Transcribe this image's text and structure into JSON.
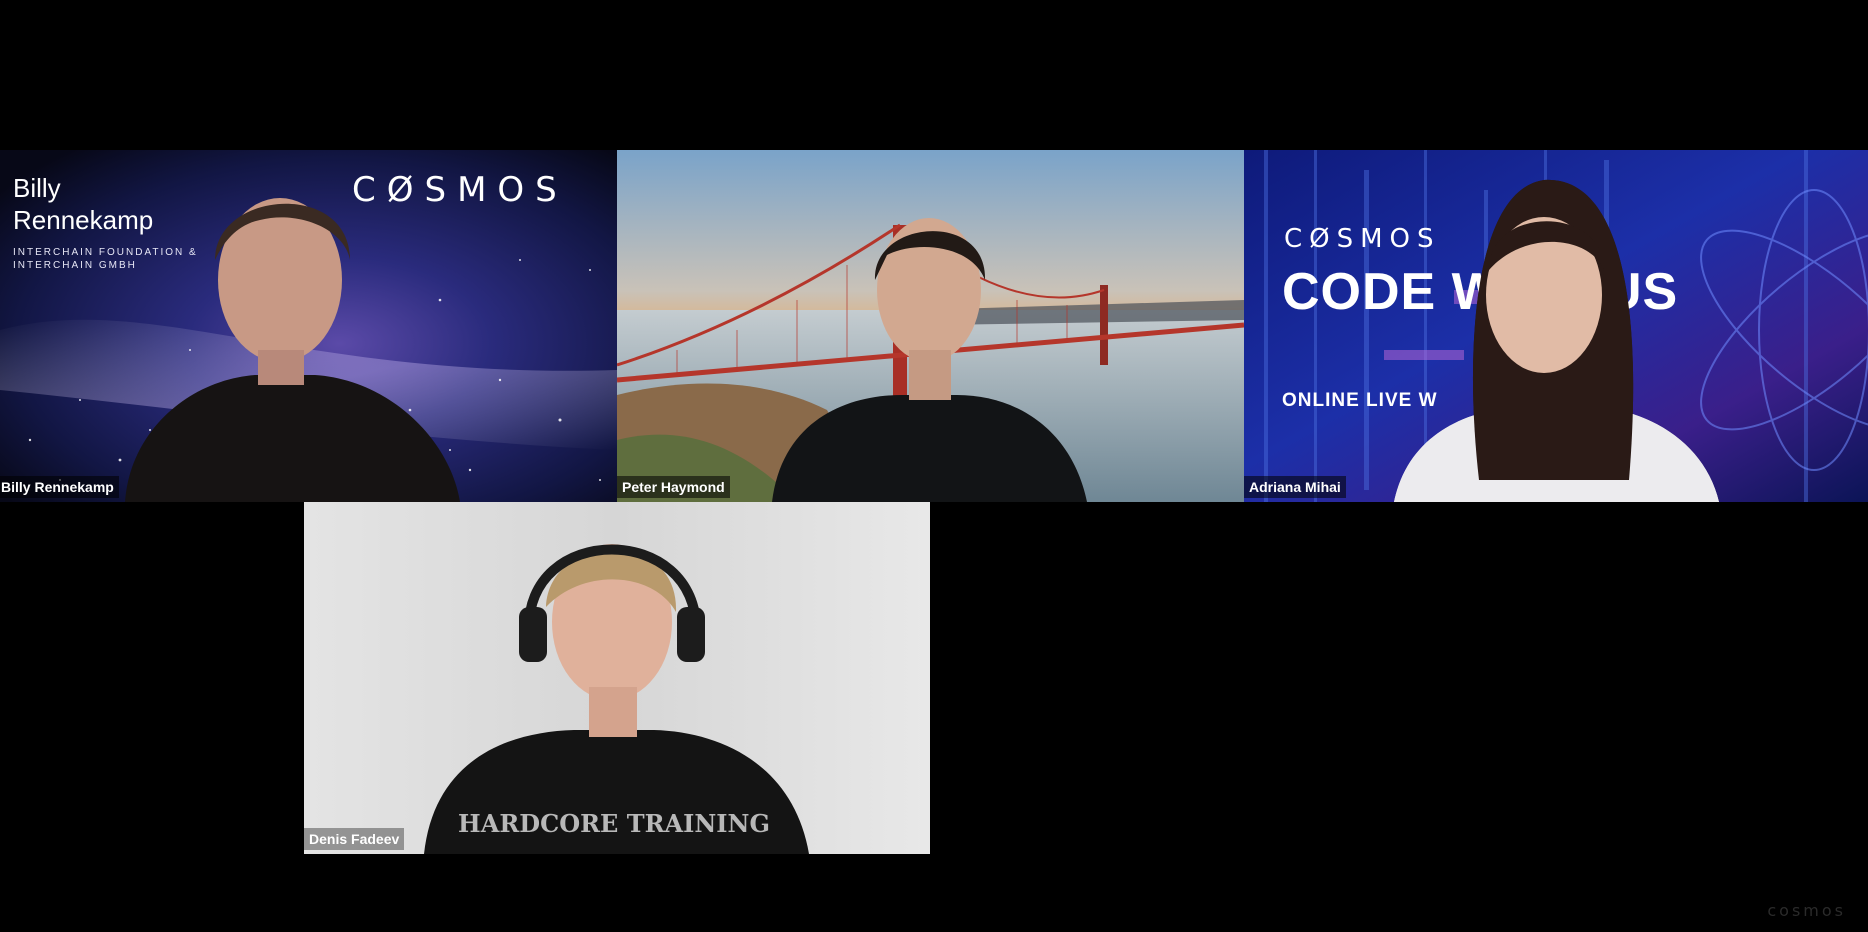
{
  "meeting": {
    "participants": [
      {
        "display_name": "Billy Rennekamp",
        "background": {
          "name_line1": "Billy",
          "name_line2": "Rennekamp",
          "org_line1": "INTERCHAIN FOUNDATION &",
          "org_line2": "INTERCHAIN GMBH",
          "brand": "CØSMOS",
          "theme": "galaxy"
        }
      },
      {
        "display_name": "Peter Haymond",
        "background": {
          "theme": "golden-gate-bridge-sunset"
        }
      },
      {
        "display_name": "Adriana Mihai",
        "background": {
          "brand": "CØSMOS",
          "headline": "CODE WITH US",
          "subline": "ONLINE LIVE W",
          "theme": "blue-code"
        }
      },
      {
        "display_name": "Denis Fadeev",
        "background": {
          "theme": "plain-wall"
        }
      }
    ]
  },
  "watermark": "cosmos",
  "colors": {
    "stage_bg": "#000000",
    "name_tag_bg": "#000000",
    "name_tag_text": "#ffffff",
    "galaxy_primary": "#1b1a5a",
    "sunset_orange": "#f2a14a",
    "bridge_red": "#b5362b",
    "code_blue": "#1c2fa8",
    "wall_gray": "#d9d9d9"
  }
}
